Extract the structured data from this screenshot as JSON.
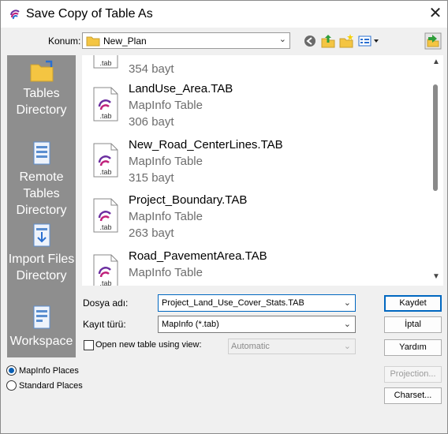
{
  "window": {
    "title": "Save Copy of Table As",
    "close_glyph": "✕"
  },
  "location": {
    "label": "Konum:",
    "value": "New_Plan"
  },
  "toolbar": {
    "icons": [
      "back-icon",
      "up-folder-icon",
      "new-folder-icon",
      "view-menu-icon",
      "select-dir-icon"
    ]
  },
  "places": [
    {
      "label": "Tables Directory",
      "icon": "folder-shortcut-icon"
    },
    {
      "label": "Remote Tables Directory",
      "icon": "remote-tables-icon"
    },
    {
      "label": "Import Files Directory",
      "icon": "import-files-icon"
    },
    {
      "label": "Workspace",
      "icon": "workspace-icon"
    }
  ],
  "files": [
    {
      "name": "",
      "type": "",
      "size": "354 bayt"
    },
    {
      "name": "LandUse_Area.TAB",
      "type": "MapInfo Table",
      "size": "306 bayt"
    },
    {
      "name": "New_Road_CenterLines.TAB",
      "type": "MapInfo Table",
      "size": "315 bayt"
    },
    {
      "name": "Project_Boundary.TAB",
      "type": "MapInfo Table",
      "size": "263 bayt"
    },
    {
      "name": "Road_PavementArea.TAB",
      "type": "MapInfo Table",
      "size": ""
    }
  ],
  "file_icon_label": ".tab",
  "form": {
    "filename_label": "Dosya adı:",
    "filename_value": "Project_Land_Use_Cover_Stats.TAB",
    "filetype_label": "Kayıt türü:",
    "filetype_value": "MapInfo (*.tab)",
    "open_view_label": "Open new table using view:",
    "open_view_checked": false,
    "view_value": "Automatic"
  },
  "buttons": {
    "save": "Kaydet",
    "cancel": "İptal",
    "help": "Yardım",
    "projection": "Projection...",
    "charset": "Charset..."
  },
  "radios": [
    {
      "label": "MapInfo Places",
      "selected": true
    },
    {
      "label": "Standard Places",
      "selected": false
    }
  ],
  "colors": {
    "accent": "#0067c0",
    "places_bg": "#8e8e8e",
    "folder": "#f4c542",
    "mapinfo_purple": "#6b2fa0"
  }
}
